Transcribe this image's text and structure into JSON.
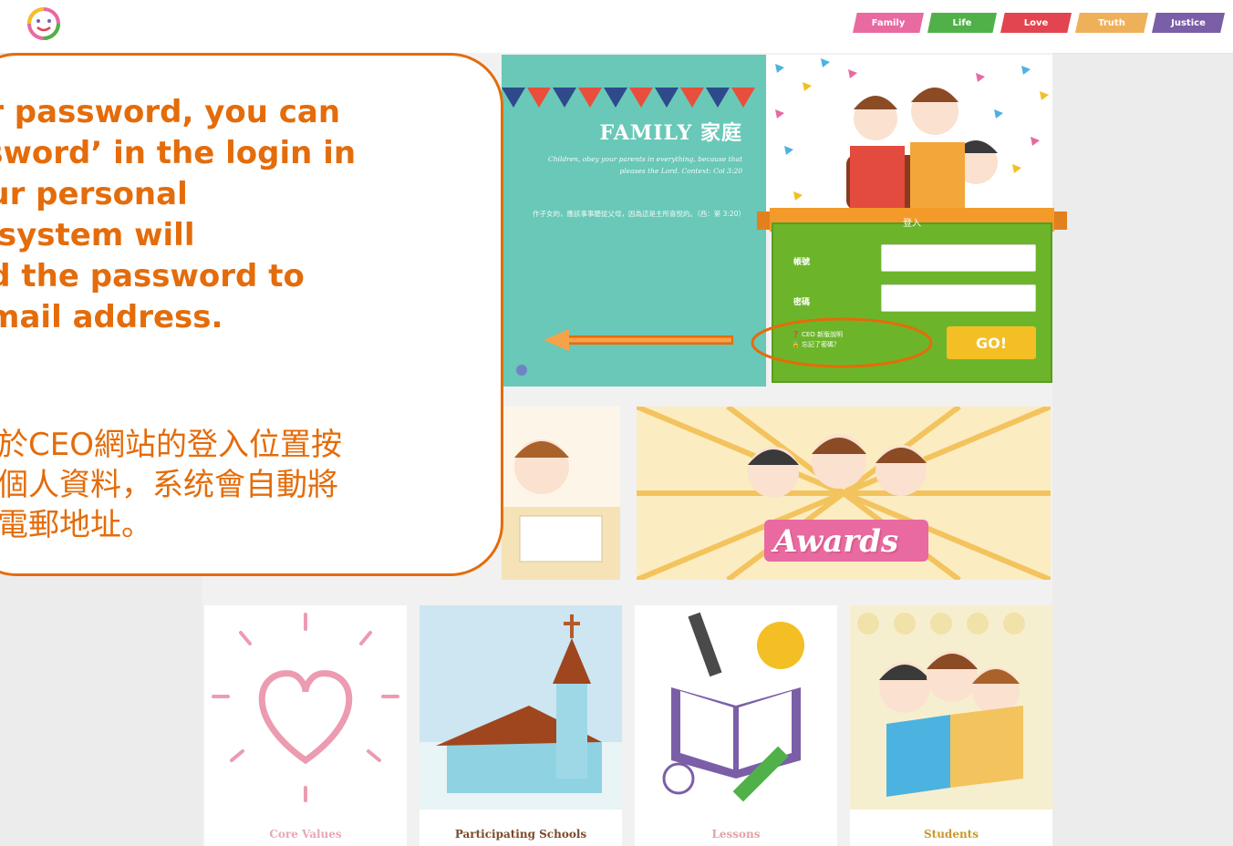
{
  "nav": {
    "tabs": [
      {
        "label": "Family",
        "color": "#e86aa0"
      },
      {
        "label": "Life",
        "color": "#4fb147"
      },
      {
        "label": "Love",
        "color": "#e2454f"
      },
      {
        "label": "Truth",
        "color": "#efb05a"
      },
      {
        "label": "Justice",
        "color": "#7b5ea8"
      }
    ]
  },
  "family_card": {
    "title": "FAMILY 家庭",
    "verse_en": "Children, obey your parents in everything, because that pleases the Lord. Context: Col 3:20",
    "verse_zh": "作子女的，應該事事聽從父母，因為這是主所喜悅的。（西：第 3:20）",
    "background": "#69c8b7"
  },
  "login": {
    "title": "登入",
    "account_label": "帳號",
    "password_label": "密碼",
    "account_value": "",
    "password_value": "",
    "faq_link": "CEO 新版說明",
    "forgot_link": "忘記了密碼？",
    "go_label": "GO!",
    "panel_color": "#6cb52a",
    "go_color": "#f3bf24"
  },
  "awards": {
    "label": "Awards"
  },
  "tiles": [
    {
      "label": "Core Values",
      "color": "#e6a9b3"
    },
    {
      "label": "Participating Schools",
      "color": "#7b4a2c"
    },
    {
      "label": "Lessons",
      "color": "#e2a3a3"
    },
    {
      "label": "Students",
      "color": "#c79a2b"
    }
  ],
  "callout": {
    "english": "ur password, you can\nssword’ in the login in\nour personal\ne system will\nnd the password to\nemail address.",
    "chinese": "可於CEO網站的登入位置按\n入個人資料，系统會自動將\n的電郵地址。",
    "accent": "#e46c0a"
  }
}
